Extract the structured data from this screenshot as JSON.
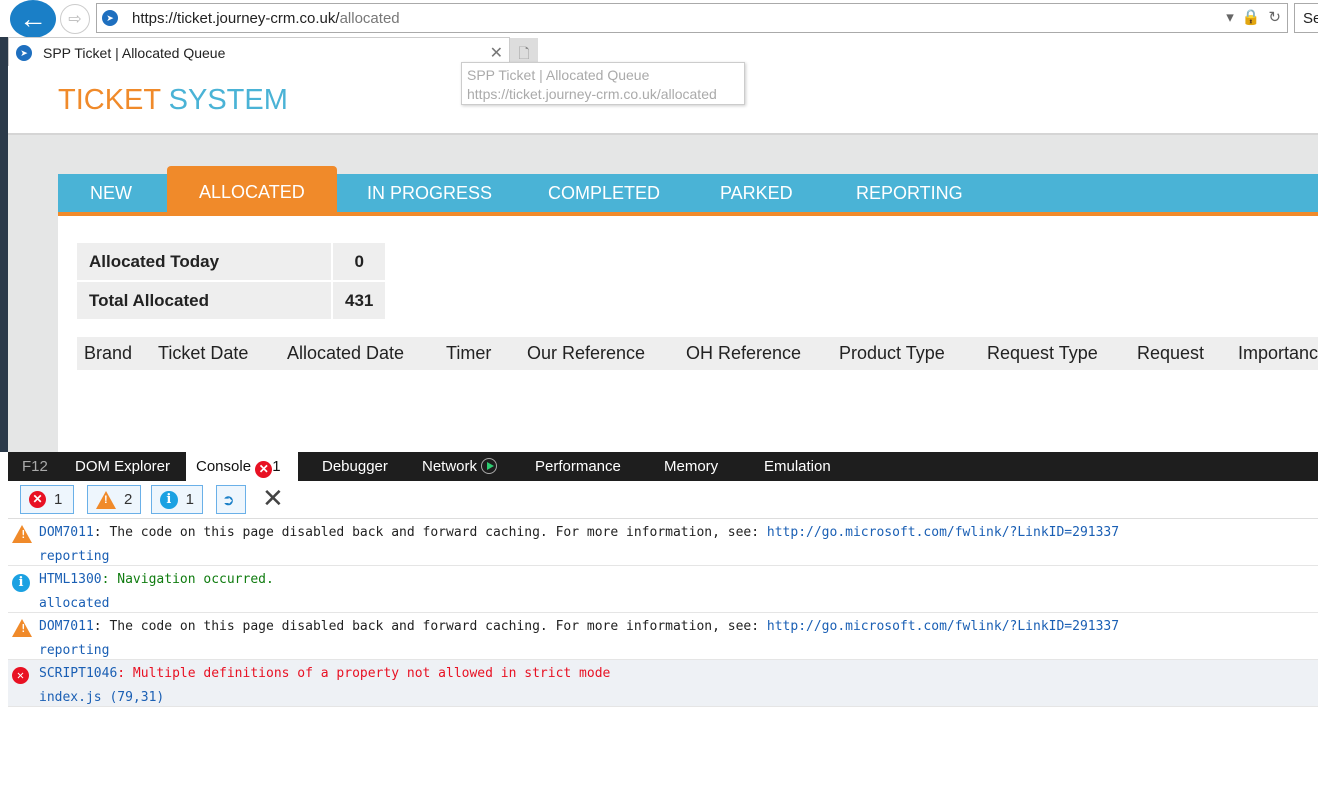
{
  "browser": {
    "url_host": "https://ticket.journey-crm.co.uk/",
    "url_path": "allocated",
    "search_placeholder": "Se",
    "tab_title": "SPP Ticket | Allocated Queue",
    "tooltip_title": "SPP Ticket | Allocated Queue",
    "tooltip_url": "https://ticket.journey-crm.co.uk/allocated"
  },
  "logo": {
    "part1": "TICKET",
    "part2": "SYSTEM"
  },
  "colors": {
    "orange": "#f08a2a",
    "blue": "#4ab3d6"
  },
  "nav": [
    "NEW",
    "ALLOCATED",
    "IN PROGRESS",
    "COMPLETED",
    "PARKED",
    "REPORTING"
  ],
  "nav_active": "ALLOCATED",
  "stats": [
    {
      "label": "Allocated Today",
      "value": "0"
    },
    {
      "label": "Total Allocated",
      "value": "431"
    }
  ],
  "columns": [
    "Brand",
    "Ticket Date",
    "Allocated Date",
    "Timer",
    "Our Reference",
    "OH Reference",
    "Product Type",
    "Request Type",
    "Request",
    "Importance"
  ],
  "devtools": {
    "tabs": [
      "F12",
      "DOM Explorer",
      "Console",
      "Debugger",
      "Network",
      "Performance",
      "Memory",
      "Emulation"
    ],
    "console_error_count": "1",
    "filters": {
      "errors": "1",
      "warnings": "2",
      "info": "1"
    },
    "messages": [
      {
        "type": "warning",
        "code": "DOM7011",
        "text": ": The code on this page disabled back and forward caching. For more information, see: ",
        "link": "http://go.microsoft.com/fwlink/?LinkID=291337",
        "source": "reporting"
      },
      {
        "type": "info",
        "code": "HTML1300",
        "text": ": Navigation occurred.",
        "link": "",
        "source": "allocated"
      },
      {
        "type": "warning",
        "code": "DOM7011",
        "text": ": The code on this page disabled back and forward caching. For more information, see: ",
        "link": "http://go.microsoft.com/fwlink/?LinkID=291337",
        "source": "reporting"
      },
      {
        "type": "error",
        "code": "SCRIPT1046",
        "text": ": Multiple definitions of a property not allowed in strict mode",
        "link": "",
        "source": "index.js (79,31)"
      }
    ]
  }
}
